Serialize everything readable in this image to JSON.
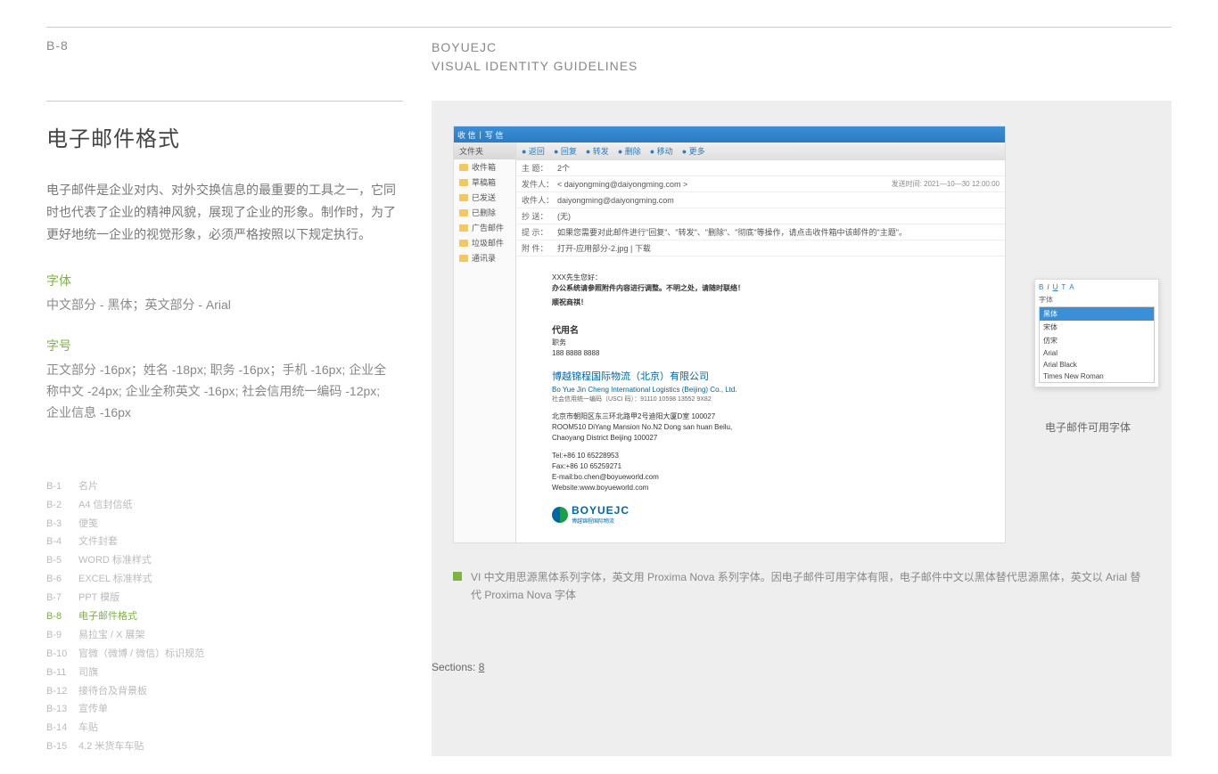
{
  "header": {
    "code": "B-8",
    "brand": "BOYUEJC",
    "sub": "VISUAL IDENTITY GUIDELINES"
  },
  "left": {
    "title": "电子邮件格式",
    "intro": "电子邮件是企业对内、对外交换信息的最重要的工具之一，它同时也代表了企业的精神风貌，展现了企业的形象。制作时，为了更好地统一企业的视觉形象，必须严格按照以下规定执行。",
    "font_h": "字体",
    "font_p": "中文部分 - 黑体；英文部分 - Arial",
    "size_h": "字号",
    "size_p": "正文部分 -16px；姓名 -18px; 职务 -16px；手机 -16px; 企业全称中文 -24px; 企业全称英文 -16px; 社会信用统一编码 -12px; 企业信息 -16px"
  },
  "toc": [
    {
      "c": "B-1",
      "l": "名片"
    },
    {
      "c": "B-2",
      "l": "A4 信封信纸"
    },
    {
      "c": "B-3",
      "l": "便笺"
    },
    {
      "c": "B-4",
      "l": "文件封套"
    },
    {
      "c": "B-5",
      "l": "WORD 标准样式"
    },
    {
      "c": "B-6",
      "l": "EXCEL 标准样式"
    },
    {
      "c": "B-7",
      "l": "PPT 模版"
    },
    {
      "c": "B-8",
      "l": "电子邮件格式"
    },
    {
      "c": "B-9",
      "l": "易拉宝 / X 展架"
    },
    {
      "c": "B-10",
      "l": "官微（微博 / 微信）标识规范"
    },
    {
      "c": "B-11",
      "l": "司旗"
    },
    {
      "c": "B-12",
      "l": "接待台及背景板"
    },
    {
      "c": "B-13",
      "l": "宣传单"
    },
    {
      "c": "B-14",
      "l": "车贴"
    },
    {
      "c": "B-15",
      "l": "4.2 米货车车贴"
    }
  ],
  "toc_active": "B-8",
  "client": {
    "tb": {
      "a": "收 信",
      "b": "写 信"
    },
    "folders_hdr": "文件夹",
    "folders": [
      "收件箱",
      "草稿箱",
      "已发送",
      "已删除",
      "广告邮件",
      "垃圾邮件",
      "通讯录"
    ],
    "actions": [
      "返回",
      "回复",
      "转发",
      "删除",
      "移动",
      "更多"
    ],
    "rows": {
      "subject_l": "主 题：",
      "subject_v": "2个",
      "from_l": "发件人：",
      "from_v": "< daiyongming@daiyongming.com >",
      "send_l": "发送时间: 2021—10—30  12:00:00",
      "to_l": "收件人：",
      "to_v": "daiyongming@daiyongming.com",
      "cc_l": "抄 送：",
      "cc_v": "(无)",
      "tip_l": "提 示：",
      "tip_v": "如果您需要对此邮件进行\"回复\"、\"转发\"、\"删除\"、\"彻底\"等操作，请点击收件箱中该邮件的\"主题\"。",
      "att_l": "附 件：",
      "att_v": "打开-应用部分-2.jpg  |  下载"
    },
    "body": {
      "greet": "XXX先生您好：",
      "line1": "办公系统请参照附件内容进行调整。不明之处，请随时联络！",
      "line2": "顺祝商祺！",
      "name": "代用名",
      "role": "职务",
      "phone": "188 8888 8888",
      "company_cn": "博越锦程国际物流（北京）有限公司",
      "company_en": "Bo Yue Jin Cheng International Logistics (Beijing) Co., Ltd.",
      "uscc": "社会信用统一编码（USCI 码）：91110 10598 13552 9X82",
      "addr_cn": "北京市朝阳区东三环北路甲2号迪阳大厦D室 100027",
      "addr_en1": "ROOM510 DiYang Mansion No.N2  Dong san huan Beilu,",
      "addr_en2": "Chaoyang District Beijing 100027",
      "tel": "Tel:+86 10 65228953",
      "fax": "Fax:+86 10 65259271",
      "email": "E-mail:bo.chen@boyueworld.com",
      "web": "Website:www.boyueworld.com",
      "logo_text": "BOYUEJC",
      "logo_cn": "博越锦程国际物流"
    }
  },
  "popup": {
    "hdr": "字体",
    "items": [
      "黑体",
      "宋体",
      "仿宋",
      "Arial",
      "Arial Black",
      "Times New Roman"
    ],
    "sel": "黑体",
    "caption": "电子邮件可用字体"
  },
  "note": "VI 中文用思源黑体系列字体，英文用 Proxima Nova 系列字体。因电子邮件可用字体有限，电子邮件中文以黑体替代思源黑体，英文以 Arial 替代 Proxima Nova 字体",
  "sections": {
    "l": "Sections:",
    "n": "8"
  }
}
